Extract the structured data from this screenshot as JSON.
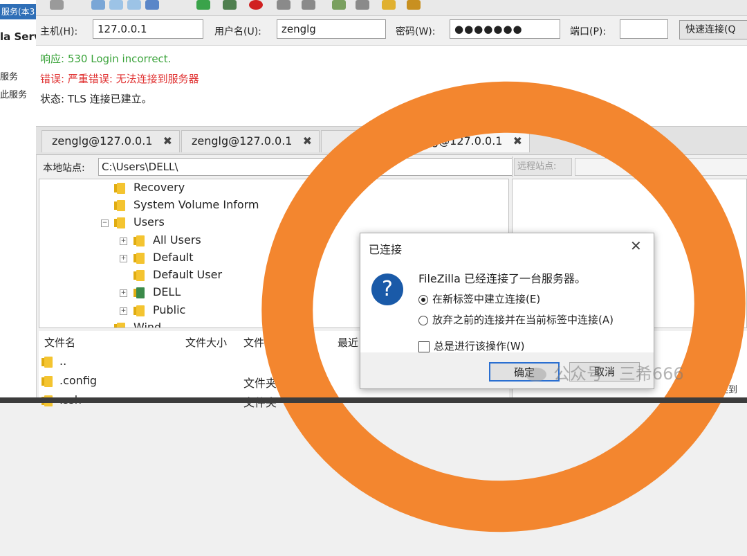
{
  "left_window": {
    "title_fragment": "服务(本3",
    "app_fragment": "la Serv",
    "line1": "服务",
    "line2": "此服务"
  },
  "quickconnect": {
    "host_label": "主机(H):",
    "host_value": "127.0.0.1",
    "user_label": "用户名(U):",
    "user_value": "zenglg",
    "password_label": "密码(W):",
    "password_value": "●●●●●●●",
    "port_label": "端口(P):",
    "port_value": "",
    "connect_button": "快速连接(Q"
  },
  "log": [
    {
      "label": "响应:",
      "text": "530 Login incorrect.",
      "color": "#3aa33a"
    },
    {
      "label": "错误:",
      "text": "严重错误: 无法连接到服务器",
      "color": "#e03030"
    },
    {
      "label": "状态:",
      "text": "TLS 连接已建立。",
      "color": "#222222"
    }
  ],
  "tabs": [
    {
      "label": "zenglg@127.0.0.1",
      "close": "✖"
    },
    {
      "label": "zenglg@127.0.0.1",
      "close": "✖"
    },
    {
      "label": "",
      "close": "✖"
    },
    {
      "label": "zenglg@127.0.0.1",
      "close": "✖"
    }
  ],
  "local_site": {
    "label": "本地站点:",
    "path": "C:\\Users\\DELL\\",
    "dropdown": "⌄"
  },
  "remote_site": {
    "label": "远程站点:"
  },
  "tree": {
    "nodes": [
      "Recovery",
      "System Volume Inform",
      "Users",
      "All Users",
      "Default",
      "Default User",
      "DELL",
      "Public",
      "Wind"
    ]
  },
  "file_list": {
    "columns": [
      "文件名",
      "文件大小",
      "文件",
      "最近"
    ],
    "rows": [
      {
        "name": "..",
        "type": ""
      },
      {
        "name": ".config",
        "type": "文件夹"
      },
      {
        "name": ".ssh",
        "type": "文件夹"
      }
    ]
  },
  "dialog": {
    "title": "已连接",
    "close": "✕",
    "icon": "?",
    "message": "FileZilla 已经连接了一台服务器。",
    "option_new_tab": "在新标签中建立连接(E)",
    "option_current_tab": "放弃之前的连接并在当前标签中连接(A)",
    "always_label": "总是进行该操作(W)",
    "ok": "确定",
    "cancel": "取消"
  },
  "watermark": "公众号 · 三希666",
  "remote_status_fragment": "连到"
}
